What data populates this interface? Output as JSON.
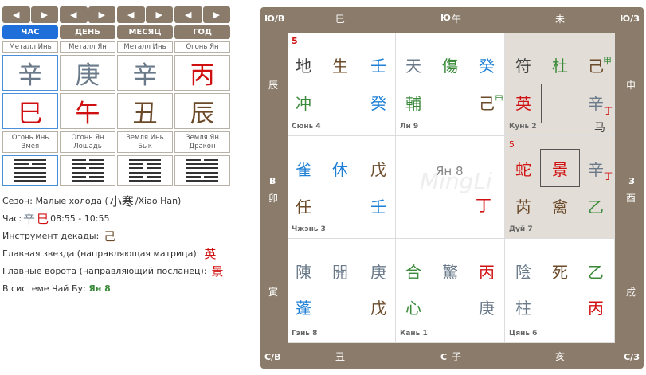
{
  "nav": {
    "prev": "◀",
    "next": "▶"
  },
  "pillars": [
    {
      "head": "ЧАС",
      "element": "Металл Инь",
      "stem": "辛",
      "branch": "巳",
      "branch_label": "Огонь Инь\nЗмея"
    },
    {
      "head": "ДЕНЬ",
      "element": "Металл Ян",
      "stem": "庚",
      "branch": "午",
      "branch_label": "Огонь Ян\nЛошадь"
    },
    {
      "head": "МЕСЯЦ",
      "element": "Металл Инь",
      "stem": "辛",
      "branch": "丑",
      "branch_label": "Земля Инь\nБык"
    },
    {
      "head": "ГОД",
      "element": "Огонь Ян",
      "stem": "丙",
      "branch": "辰",
      "branch_label": "Земля Ян\nДракон"
    }
  ],
  "info": {
    "season_label": "Сезон:",
    "season_value": "Малые холода (",
    "season_chars": "小寒",
    "season_tail": "/Xiao Han)",
    "hour_label": "Час:",
    "hour_stem": "辛",
    "hour_branch": "巳",
    "hour_time": "08:55 - 10:55",
    "decade_label": "Инструмент декады:",
    "decade_value": "己",
    "star_label": "Главная звезда (направляющая матрица):",
    "star_value": "英",
    "gate_label": "Главные ворота (направляющий посланец):",
    "gate_value": "景",
    "chaibu_label": "В системе Чай Бу:",
    "chaibu_value": "Ян 8"
  },
  "board": {
    "corner_tl": "Ю/В",
    "corner_tr": "Ю/З",
    "corner_bl": "С/В",
    "corner_br": "С/З",
    "top": [
      "巳",
      "Ю",
      "午",
      "未"
    ],
    "bottom": [
      "丑",
      "С",
      "子",
      "亥"
    ],
    "left": [
      "辰",
      "В",
      "卯",
      "寅"
    ],
    "right": [
      "申",
      "З",
      "酉",
      "戌"
    ],
    "cells": [
      {
        "caption": "Сюнь 4",
        "num": "5",
        "r1": [
          "地",
          "生",
          "壬"
        ],
        "r2": [
          "冲",
          "",
          "癸"
        ]
      },
      {
        "caption": "Ли 9",
        "r1": [
          "天",
          "傷",
          "癸"
        ],
        "r2": [
          "輔",
          "",
          "己"
        ],
        "sup": "甲"
      },
      {
        "caption": "Кунь 2",
        "r1": [
          "符",
          "杜",
          "己"
        ],
        "r1sup": "甲",
        "r2": [
          "英",
          "",
          "辛"
        ],
        "r2sup": "丁",
        "extra": "马"
      },
      {
        "caption": "Чжэнь 3",
        "r1": [
          "雀",
          "休",
          "戊"
        ],
        "r2": [
          "任",
          "",
          "壬"
        ]
      },
      {
        "caption": "",
        "center": "Ян 8",
        "center_val": "丁",
        "watermark": "MingLi"
      },
      {
        "caption": "Дуй 7",
        "num": "5",
        "r1": [
          "蛇",
          "景",
          "辛"
        ],
        "r1sup": "丁",
        "r2": [
          "芮",
          "禽",
          "乙"
        ]
      },
      {
        "caption": "Гэнь 8",
        "r1": [
          "陳",
          "開",
          "庚"
        ],
        "r2": [
          "蓬",
          "",
          "戊"
        ]
      },
      {
        "caption": "Кань 1",
        "r1": [
          "合",
          "驚",
          "丙"
        ],
        "r2": [
          "心",
          "",
          "庚"
        ]
      },
      {
        "caption": "Цянь 6",
        "r1": [
          "陰",
          "死",
          "乙"
        ],
        "r2": [
          "柱",
          "",
          "丙"
        ]
      }
    ]
  }
}
